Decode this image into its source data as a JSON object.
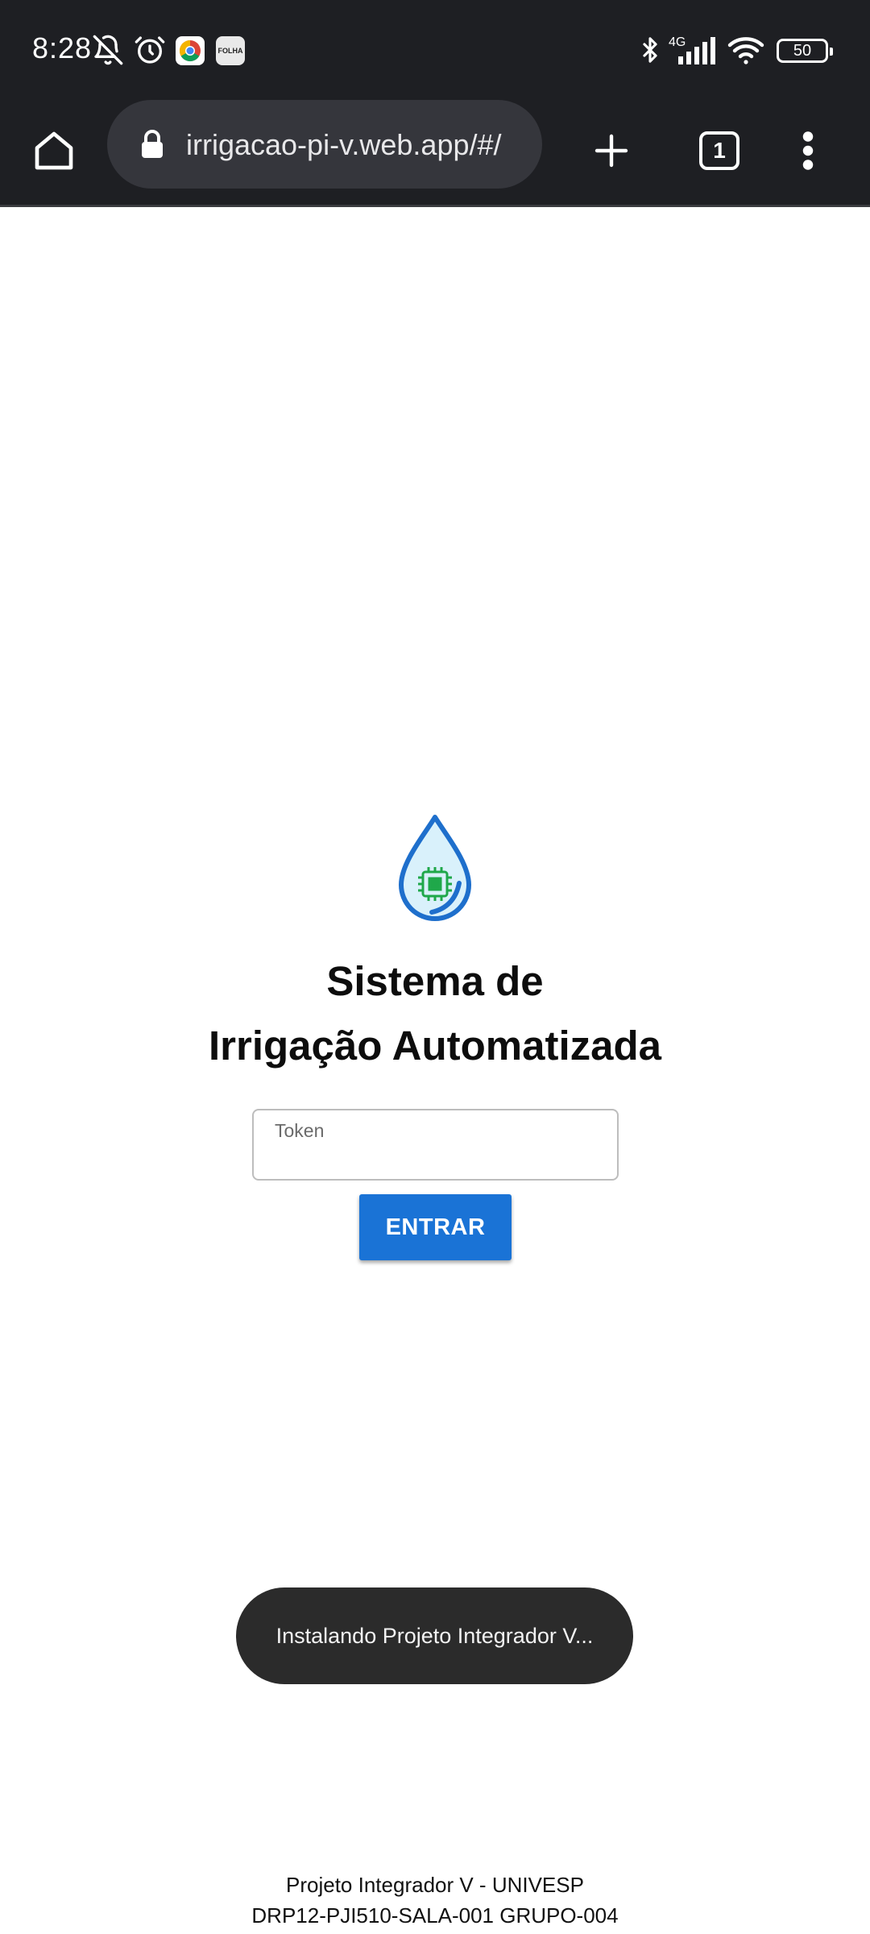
{
  "status_bar": {
    "time": "8:28",
    "network": "4G",
    "battery": "50",
    "icons": [
      "bell-off-icon",
      "alarm-icon",
      "chrome-app-icon",
      "folha-app-icon",
      "bluetooth-icon",
      "signal-icon",
      "wifi-icon",
      "battery-icon"
    ],
    "folha_badge_text": "FOLHA"
  },
  "browser": {
    "url": "irrigacao-pi-v.web.app/#/",
    "tab_count": "1",
    "icons": [
      "home-icon",
      "lock-icon",
      "plus-icon",
      "tabs-icon",
      "more-vert-icon"
    ]
  },
  "login": {
    "title_line1": "Sistema de",
    "title_line2": "Irrigação Automatizada",
    "token_label": "Token",
    "token_value": "",
    "button_label": "ENTRAR"
  },
  "toast": {
    "message": "Instalando Projeto Integrador V..."
  },
  "footer": {
    "line1": "Projeto Integrador V - UNIVESP",
    "line2": "DRP12-PJI510-SALA-001 GRUPO-004"
  },
  "colors": {
    "status_bar_bg": "#1e1f23",
    "url_pill_bg": "#35363c",
    "primary_button": "#1a73d6",
    "logo_blue": "#1e6fcc",
    "logo_fill": "#d9f1fb",
    "chip_green": "#1fa84a",
    "toast_bg": "#2b2b2b"
  }
}
